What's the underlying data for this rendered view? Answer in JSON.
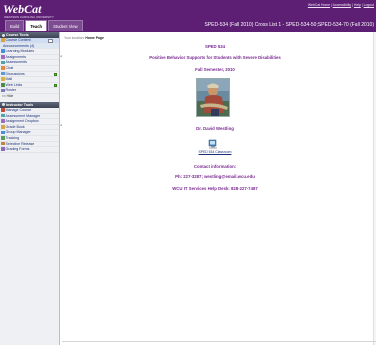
{
  "header": {
    "logo": "WebCat",
    "logo_subtitle": "WESTERN CAROLINA UNIVERSITY",
    "links": [
      "WebCat Home",
      "Accessibility",
      "Help",
      "Logout"
    ],
    "course_title": "SPED-534 (Fall 2010) Cross List 1 - SPED-534-50;SPED-534-70 (Fall 2010)",
    "tabs": [
      {
        "label": "Build",
        "active": false
      },
      {
        "label": "Teach",
        "active": true
      },
      {
        "label": "Student View",
        "active": false
      }
    ]
  },
  "sidebar": {
    "course_tools": {
      "heading": "Course Tools",
      "items": [
        {
          "label": "Course Content",
          "icon": "folder-icon",
          "color": "#d9a441",
          "dropdown": true
        },
        {
          "label": "Announcements (4)",
          "sub": true
        },
        {
          "label": "Learning Modules",
          "icon": "modules-icon",
          "color": "#4a8dd8"
        },
        {
          "label": "Assignments",
          "icon": "assignments-icon",
          "color": "#9b6bc0"
        },
        {
          "label": "Assessments",
          "icon": "assessments-icon",
          "color": "#4aa6a6"
        },
        {
          "label": "Chat",
          "icon": "chat-icon",
          "color": "#e08a3e"
        },
        {
          "label": "Discussions",
          "icon": "discussions-icon",
          "color": "#5b9bd5",
          "badge": true
        },
        {
          "label": "Mail",
          "icon": "mail-icon",
          "color": "#d9b341"
        },
        {
          "label": "Web Links",
          "icon": "weblinks-icon",
          "color": "#4a8d4a",
          "badge": true
        },
        {
          "label": "Roster",
          "icon": "roster-icon",
          "color": "#7a7ab8"
        }
      ],
      "hide_label": "<< Hide"
    },
    "instructor_tools": {
      "heading": "Instructor Tools",
      "items": [
        {
          "label": "Manage Course",
          "icon": "manage-icon",
          "color": "#c04b3a"
        },
        {
          "label": "Assessment Manager",
          "icon": "assessment-manager-icon",
          "color": "#4aa6a6"
        },
        {
          "label": "Assignment Dropbox",
          "icon": "dropbox-icon",
          "color": "#9b6bc0"
        },
        {
          "label": "Grade Book",
          "icon": "gradebook-icon",
          "color": "#d9a441"
        },
        {
          "label": "Group Manager",
          "icon": "group-icon",
          "color": "#4a8dd8"
        },
        {
          "label": "Tracking",
          "icon": "tracking-icon",
          "color": "#5b9b5b"
        },
        {
          "label": "Selective Release",
          "icon": "release-icon",
          "color": "#c0853a"
        },
        {
          "label": "Grading Forms",
          "icon": "forms-icon",
          "color": "#8a6bb8"
        }
      ]
    }
  },
  "main": {
    "location_label": "Your location:",
    "location_value": "Home Page",
    "lines": [
      "SPED 534",
      "Positive Behavior Supports for Students with Severe Disabilities",
      "Fall Semester, 2010"
    ],
    "instructor": "Dr. David Westling",
    "classroom_link": "SPED 534 Classroom",
    "contact_heading": "Contact information:",
    "contact_phone": "Ph: 227-3287; westling@email.wcu.edu",
    "helpdesk": "WCU IT Services Help Desk: 828-227-7487"
  }
}
